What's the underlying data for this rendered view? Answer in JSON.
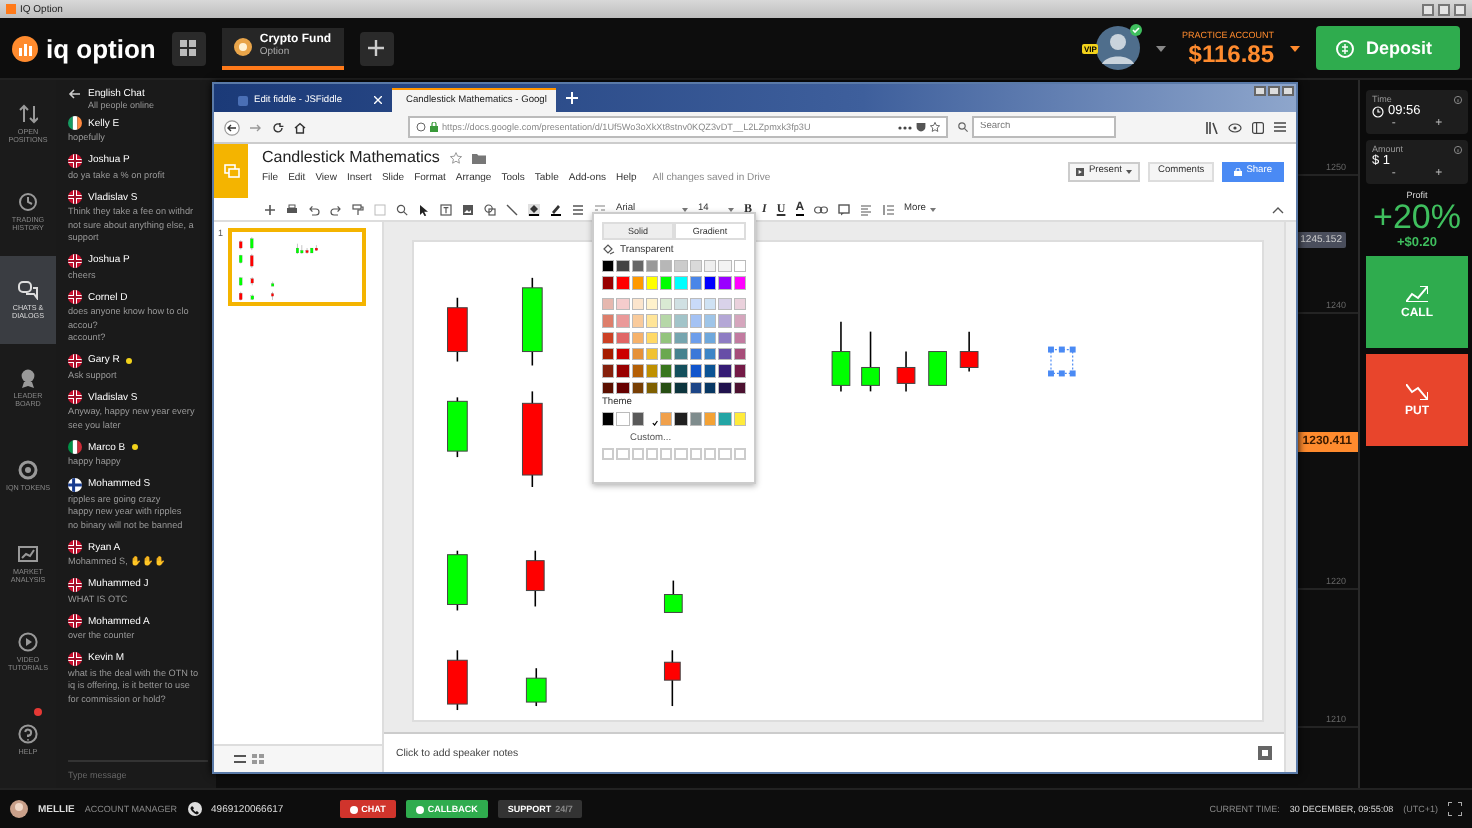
{
  "window": {
    "title": "IQ Option"
  },
  "topbar": {
    "logo": "iq option",
    "asset_tab": {
      "name": "Crypto Fund",
      "type": "Option",
      "selected": true
    },
    "vip": "VIP",
    "account_label": "PRACTICE ACCOUNT",
    "balance": "$116.85",
    "deposit": "Deposit"
  },
  "nav": [
    {
      "label": "OPEN POSITIONS",
      "kind": "positions",
      "selected": false,
      "badge": false
    },
    {
      "label": "TRADING HISTORY",
      "kind": "history",
      "selected": false,
      "badge": false
    },
    {
      "label": "CHATS & DIALOGS",
      "kind": "chat",
      "selected": true,
      "badge": false
    },
    {
      "label": "LEADER BOARD",
      "kind": "leader",
      "selected": false,
      "badge": false
    },
    {
      "label": "IQN TOKENS",
      "kind": "token",
      "selected": false,
      "badge": false
    },
    {
      "label": "MARKET ANALYSIS",
      "kind": "analysis",
      "selected": false,
      "badge": false
    },
    {
      "label": "VIDEO TUTORIALS",
      "kind": "video",
      "selected": false,
      "badge": false
    },
    {
      "label": "HELP",
      "kind": "help",
      "selected": false,
      "badge": true
    }
  ],
  "chat": {
    "title": "English Chat",
    "subtitle": "All people online",
    "placeholder": "Type message",
    "messages": [
      {
        "name": "Kelly E",
        "kind": "ie",
        "online": false,
        "lines": [
          "hopefully"
        ]
      },
      {
        "name": "Joshua P",
        "kind": "gb",
        "online": false,
        "lines": [
          "do ya take a % on profit"
        ]
      },
      {
        "name": "Vladislav S",
        "kind": "gb",
        "online": false,
        "lines": [
          "Think they take a fee on withdr",
          "not sure about anything else, a",
          "support"
        ]
      },
      {
        "name": "Joshua P",
        "kind": "gb",
        "online": false,
        "lines": [
          "cheers"
        ]
      },
      {
        "name": "Cornel D",
        "kind": "gb",
        "online": false,
        "lines": [
          "does anyone know how to clo",
          "accou?",
          "account?"
        ]
      },
      {
        "name": "Gary R",
        "kind": "gb",
        "online": true,
        "lines": [
          "Ask support"
        ]
      },
      {
        "name": "Vladislav S",
        "kind": "gb",
        "online": false,
        "lines": [
          "Anyway, happy new year every",
          "see you later"
        ]
      },
      {
        "name": "Marco B",
        "kind": "it",
        "online": true,
        "lines": [
          "happy happy"
        ]
      },
      {
        "name": "Mohammed S",
        "kind": "fi",
        "online": false,
        "lines": [
          "ripples are going crazy",
          "happy new year with ripples",
          "no binary will not be banned"
        ]
      },
      {
        "name": "Ryan A",
        "kind": "gb",
        "online": false,
        "lines": [
          "Mohammed S, ✋✋✋"
        ]
      },
      {
        "name": "Muhammed J",
        "kind": "gb",
        "online": false,
        "lines": [
          "WHAT IS OTC"
        ]
      },
      {
        "name": "Mohammed A",
        "kind": "gb",
        "online": false,
        "lines": [
          "over the counter"
        ]
      },
      {
        "name": "Kevin M",
        "kind": "gb",
        "online": false,
        "lines": [
          "what is the deal with the OTN to",
          "iq is offering, is it better to use",
          "for commission or hold?"
        ]
      }
    ]
  },
  "chart": {
    "price_labels": [
      "1250",
      "1240",
      "1220",
      "1210"
    ],
    "current_price": "1245.152",
    "strike_price": "1230.411"
  },
  "trade": {
    "time_label": "Time",
    "time": "09:56",
    "amount_label": "Amount",
    "amount": "$ 1",
    "steppers": [
      "-",
      "+"
    ],
    "profit_label": "Profit",
    "profit": "+20%",
    "profit_amount": "+$0.20",
    "call": "CALL",
    "put": "PUT"
  },
  "browser": {
    "tabs": [
      {
        "title": "Edit fiddle - JSFiddle",
        "selected": false
      },
      {
        "title": "Candlestick Mathematics - Googl",
        "selected": true
      }
    ],
    "url": "https://docs.google.com/presentation/d/1Uf5Wo3oXkXt8stnv0KQZ3vDT__L2LZpmxk3fp3U",
    "search_placeholder": "Search"
  },
  "slides": {
    "title": "Candlestick Mathematics",
    "menu": [
      "File",
      "Edit",
      "View",
      "Insert",
      "Slide",
      "Format",
      "Arrange",
      "Tools",
      "Table",
      "Add-ons",
      "Help"
    ],
    "save_status": "All changes saved in Drive",
    "present": "Present",
    "comments": "Comments",
    "share": "Share",
    "font": "Arial",
    "size": "14",
    "format_buttons": [
      "B",
      "I",
      "U",
      "A"
    ],
    "more": "More",
    "slide_number": "1",
    "notes_placeholder": "Click to add speaker notes"
  },
  "color_picker": {
    "tabs": [
      {
        "label": "Solid",
        "selected": true
      },
      {
        "label": "Gradient",
        "selected": false
      }
    ],
    "transparent": "Transparent",
    "palette": [
      [
        {
          "color": "#000000"
        },
        {
          "color": "#434343"
        },
        {
          "color": "#666666"
        },
        {
          "color": "#999999"
        },
        {
          "color": "#b7b7b7"
        },
        {
          "color": "#cccccc"
        },
        {
          "color": "#d9d9d9"
        },
        {
          "color": "#efefef"
        },
        {
          "color": "#f3f3f3"
        },
        {
          "color": "#ffffff"
        }
      ],
      [
        {
          "color": "#980000"
        },
        {
          "color": "#ff0000"
        },
        {
          "color": "#ff9900"
        },
        {
          "color": "#ffff00"
        },
        {
          "color": "#00ff00"
        },
        {
          "color": "#00ffff"
        },
        {
          "color": "#4a86e8"
        },
        {
          "color": "#0000ff"
        },
        {
          "color": "#9900ff"
        },
        {
          "color": "#ff00ff"
        }
      ],
      [
        {
          "color": "#e6b8af"
        },
        {
          "color": "#f4cccc"
        },
        {
          "color": "#fce5cd"
        },
        {
          "color": "#fff2cc"
        },
        {
          "color": "#d9ead3"
        },
        {
          "color": "#d0e0e3"
        },
        {
          "color": "#c9daf8"
        },
        {
          "color": "#cfe2f3"
        },
        {
          "color": "#d9d2e9"
        },
        {
          "color": "#ead1dc"
        }
      ],
      [
        {
          "color": "#dd7e6b"
        },
        {
          "color": "#ea9999"
        },
        {
          "color": "#f9cb9c"
        },
        {
          "color": "#ffe599"
        },
        {
          "color": "#b6d7a8"
        },
        {
          "color": "#a2c4c9"
        },
        {
          "color": "#a4c2f4"
        },
        {
          "color": "#9fc5e8"
        },
        {
          "color": "#b4a7d6"
        },
        {
          "color": "#d5a6bd"
        }
      ],
      [
        {
          "color": "#cc4125"
        },
        {
          "color": "#e06666"
        },
        {
          "color": "#f6b26b"
        },
        {
          "color": "#ffd966"
        },
        {
          "color": "#93c47d"
        },
        {
          "color": "#76a5af"
        },
        {
          "color": "#6d9eeb"
        },
        {
          "color": "#6fa8dc"
        },
        {
          "color": "#8e7cc3"
        },
        {
          "color": "#c27ba0"
        }
      ],
      [
        {
          "color": "#a61c00"
        },
        {
          "color": "#cc0000"
        },
        {
          "color": "#e69138"
        },
        {
          "color": "#f1c232"
        },
        {
          "color": "#6aa84f"
        },
        {
          "color": "#45818e"
        },
        {
          "color": "#3c78d8"
        },
        {
          "color": "#3d85c6"
        },
        {
          "color": "#674ea7"
        },
        {
          "color": "#a64d79"
        }
      ],
      [
        {
          "color": "#85200c"
        },
        {
          "color": "#990000"
        },
        {
          "color": "#b45f06"
        },
        {
          "color": "#bf9000"
        },
        {
          "color": "#38761d"
        },
        {
          "color": "#134f5c"
        },
        {
          "color": "#1155cc"
        },
        {
          "color": "#0b5394"
        },
        {
          "color": "#351c75"
        },
        {
          "color": "#741b47"
        }
      ],
      [
        {
          "color": "#5b0f00"
        },
        {
          "color": "#660000"
        },
        {
          "color": "#783f04"
        },
        {
          "color": "#7f6000"
        },
        {
          "color": "#274e13"
        },
        {
          "color": "#0c343d"
        },
        {
          "color": "#1c4587"
        },
        {
          "color": "#073763"
        },
        {
          "color": "#20124d"
        },
        {
          "color": "#4c1130"
        }
      ]
    ],
    "theme_label": "Theme",
    "theme": [
      {
        "color": "#000000",
        "selected": false
      },
      {
        "color": "#ffffff",
        "selected": false
      },
      {
        "color": "#595959",
        "selected": false
      },
      {
        "color": "#ffffff",
        "selected": true
      },
      {
        "color": "#f0a04b",
        "selected": false
      },
      {
        "color": "#1f1f1f",
        "selected": false
      },
      {
        "color": "#7f8c8d",
        "selected": false
      },
      {
        "color": "#f4a235",
        "selected": false
      },
      {
        "color": "#23a5a5",
        "selected": false
      },
      {
        "color": "#ffeb3b",
        "selected": false
      }
    ],
    "custom": "Custom..."
  },
  "bottom_bar": {
    "manager_name": "MELLIE",
    "manager_role": "ACCOUNT MANAGER",
    "phone": "4969120066617",
    "chat": "CHAT",
    "callback": "CALLBACK",
    "support": "SUPPORT",
    "support_hours": "24/7",
    "time_label": "CURRENT TIME:",
    "time": "30 DECEMBER, 09:55:08",
    "timezone": "(UTC+1)"
  }
}
